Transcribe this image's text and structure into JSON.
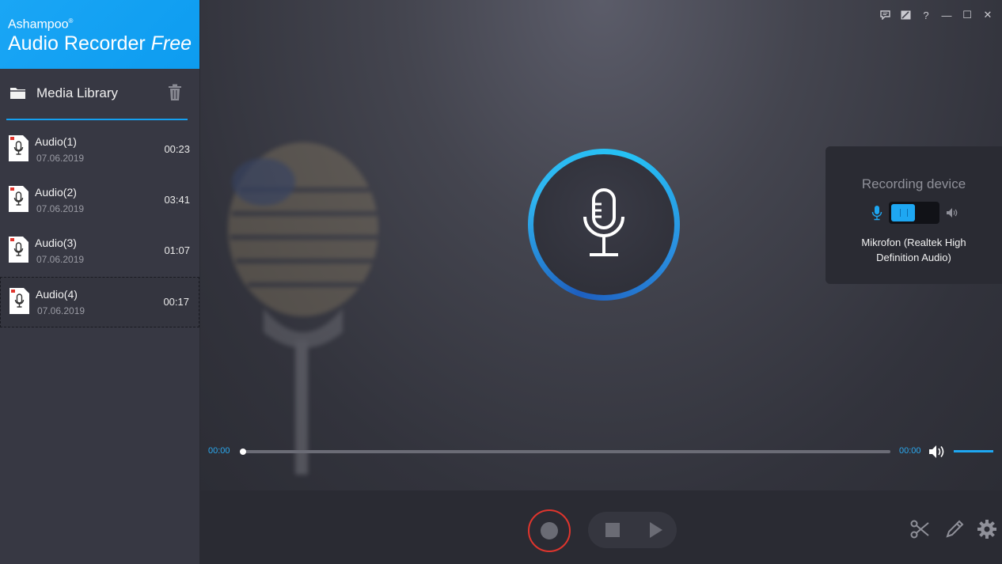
{
  "app": {
    "vendor": "Ashampoo",
    "vendor_mark": "®",
    "product": "Audio Recorder",
    "edition": "Free"
  },
  "library": {
    "title": "Media Library",
    "items": [
      {
        "name": "Audio(1)",
        "date": "07.06.2019",
        "duration": "00:23"
      },
      {
        "name": "Audio(2)",
        "date": "07.06.2019",
        "duration": "03:41"
      },
      {
        "name": "Audio(3)",
        "date": "07.06.2019",
        "duration": "01:07"
      },
      {
        "name": "Audio(4)",
        "date": "07.06.2019",
        "duration": "00:17"
      }
    ],
    "selected_index": 3
  },
  "window_controls": {
    "feedback_icon": "chat-icon",
    "skin_icon": "skin-icon",
    "help": "?",
    "minimize": "—",
    "maximize": "☐",
    "close": "✕"
  },
  "recording_device": {
    "label": "Recording device",
    "device": "Mikrofon (Realtek High Definition Audio)",
    "mode": "microphone"
  },
  "player": {
    "current_time": "00:00",
    "total_time": "00:00",
    "progress": 0,
    "volume": 1.0
  },
  "colors": {
    "accent": "#1ea7f2",
    "record": "#e0352d"
  }
}
